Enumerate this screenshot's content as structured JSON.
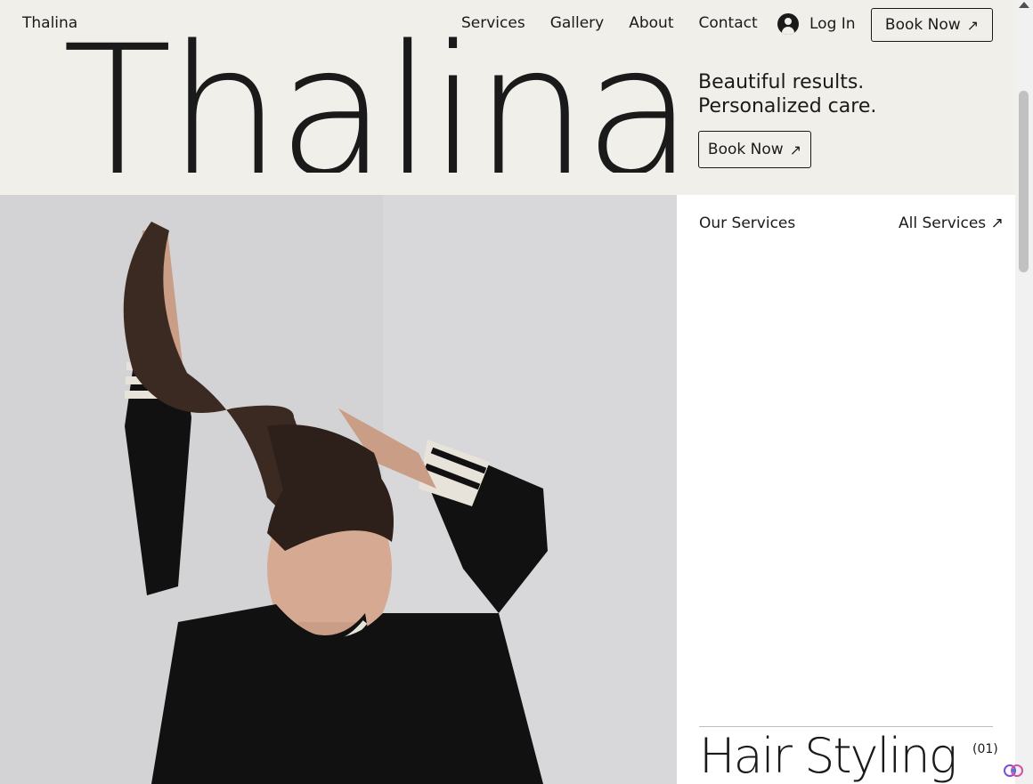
{
  "header": {
    "brand": "Thalina",
    "nav": [
      "Services",
      "Gallery",
      "About",
      "Contact"
    ],
    "login_label": "Log In",
    "book_now_label": "Book Now"
  },
  "hero": {
    "big_title": "Thalina",
    "tagline_line1": "Beautiful results.",
    "tagline_line2": "Personalized care.",
    "book_now_label": "Book Now"
  },
  "services": {
    "heading": "Our Services",
    "all_services_label": "All Services",
    "items": [
      {
        "title": "Hair Styling",
        "number": "(01)"
      }
    ]
  },
  "icons": {
    "arrow": "arrow-up-right-icon",
    "user": "user-avatar-icon",
    "assistant": "ai-assistant-icon"
  },
  "colors": {
    "header_bg": "#f1efea",
    "text": "#1a1a1a",
    "photo_bg": "#d2d2d4"
  }
}
